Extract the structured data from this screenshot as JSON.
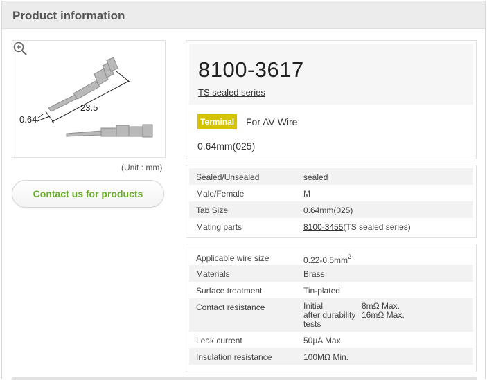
{
  "header": {
    "title": "Product information"
  },
  "image": {
    "dim_label_1": "0.64",
    "dim_label_2": "23.5",
    "unit_note": "(Unit : mm)"
  },
  "contact_button": {
    "label": "Contact us for products"
  },
  "product": {
    "part_number": "8100-3617",
    "series_link": "TS sealed series",
    "tag": "Terminal",
    "tag_text": "For AV Wire",
    "size": "0.64mm(025)"
  },
  "specs1": [
    {
      "key": "Sealed/Unsealed",
      "value": "sealed"
    },
    {
      "key": "Male/Female",
      "value": "M"
    },
    {
      "key": "Tab Size",
      "value": "0.64mm(025)"
    },
    {
      "key": "Mating parts",
      "link": "8100-3455",
      "value": "(TS sealed series)"
    }
  ],
  "specs2": {
    "wire_size": {
      "key": "Applicable wire size",
      "value": "0.22-0.5mm",
      "sup": "2"
    },
    "materials": {
      "key": "Materials",
      "value": "Brass"
    },
    "surface": {
      "key": "Surface treatment",
      "value": "Tin-plated"
    },
    "contact": {
      "key": "Contact resistance",
      "initial_label": "Initial",
      "initial_value": "8mΩ Max.",
      "after_label": "after durability tests",
      "after_value": "16mΩ Max."
    },
    "leak": {
      "key": "Leak current",
      "value": "50μA Max."
    },
    "insulation": {
      "key": "Insulation resistance",
      "value": "100MΩ Min."
    }
  },
  "colors": {
    "accent_green": "#6aaa2a",
    "tag_yellow": "#d4c400"
  }
}
